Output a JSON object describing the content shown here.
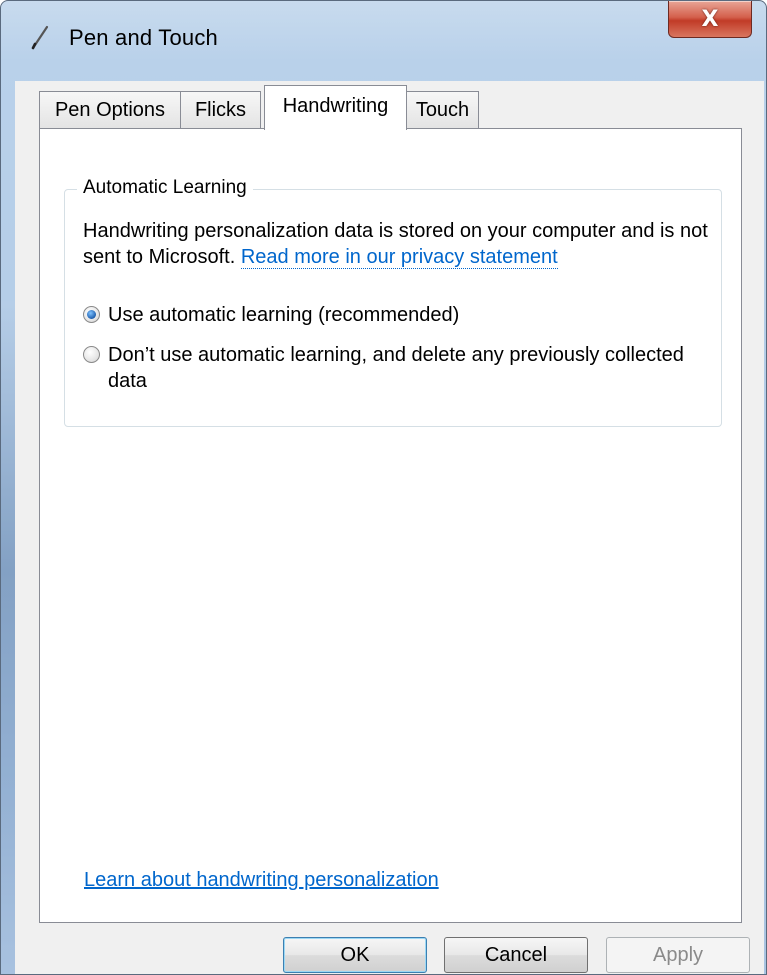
{
  "window": {
    "title": "Pen and Touch",
    "title_icon": "pen-icon",
    "close_glyph": "X"
  },
  "tabs": [
    {
      "label": "Pen Options",
      "active": false
    },
    {
      "label": "Flicks",
      "active": false
    },
    {
      "label": "Handwriting",
      "active": true
    },
    {
      "label": "Touch",
      "active": false
    }
  ],
  "group": {
    "legend": "Automatic Learning",
    "info_text": "Handwriting personalization data is stored on your computer and is not sent to Microsoft. ",
    "privacy_link": "Read more in our privacy statement",
    "options": [
      {
        "label": "Use automatic learning (recommended)",
        "selected": true
      },
      {
        "label": "Don’t use automatic learning, and delete any previously collected data",
        "selected": false
      }
    ]
  },
  "learn_link": "Learn about handwriting personalization",
  "buttons": {
    "ok": "OK",
    "cancel": "Cancel",
    "apply": "Apply"
  },
  "colors": {
    "link": "#0066cc",
    "close_button": "#c13b27",
    "radio_selected": "#1f5fae"
  }
}
